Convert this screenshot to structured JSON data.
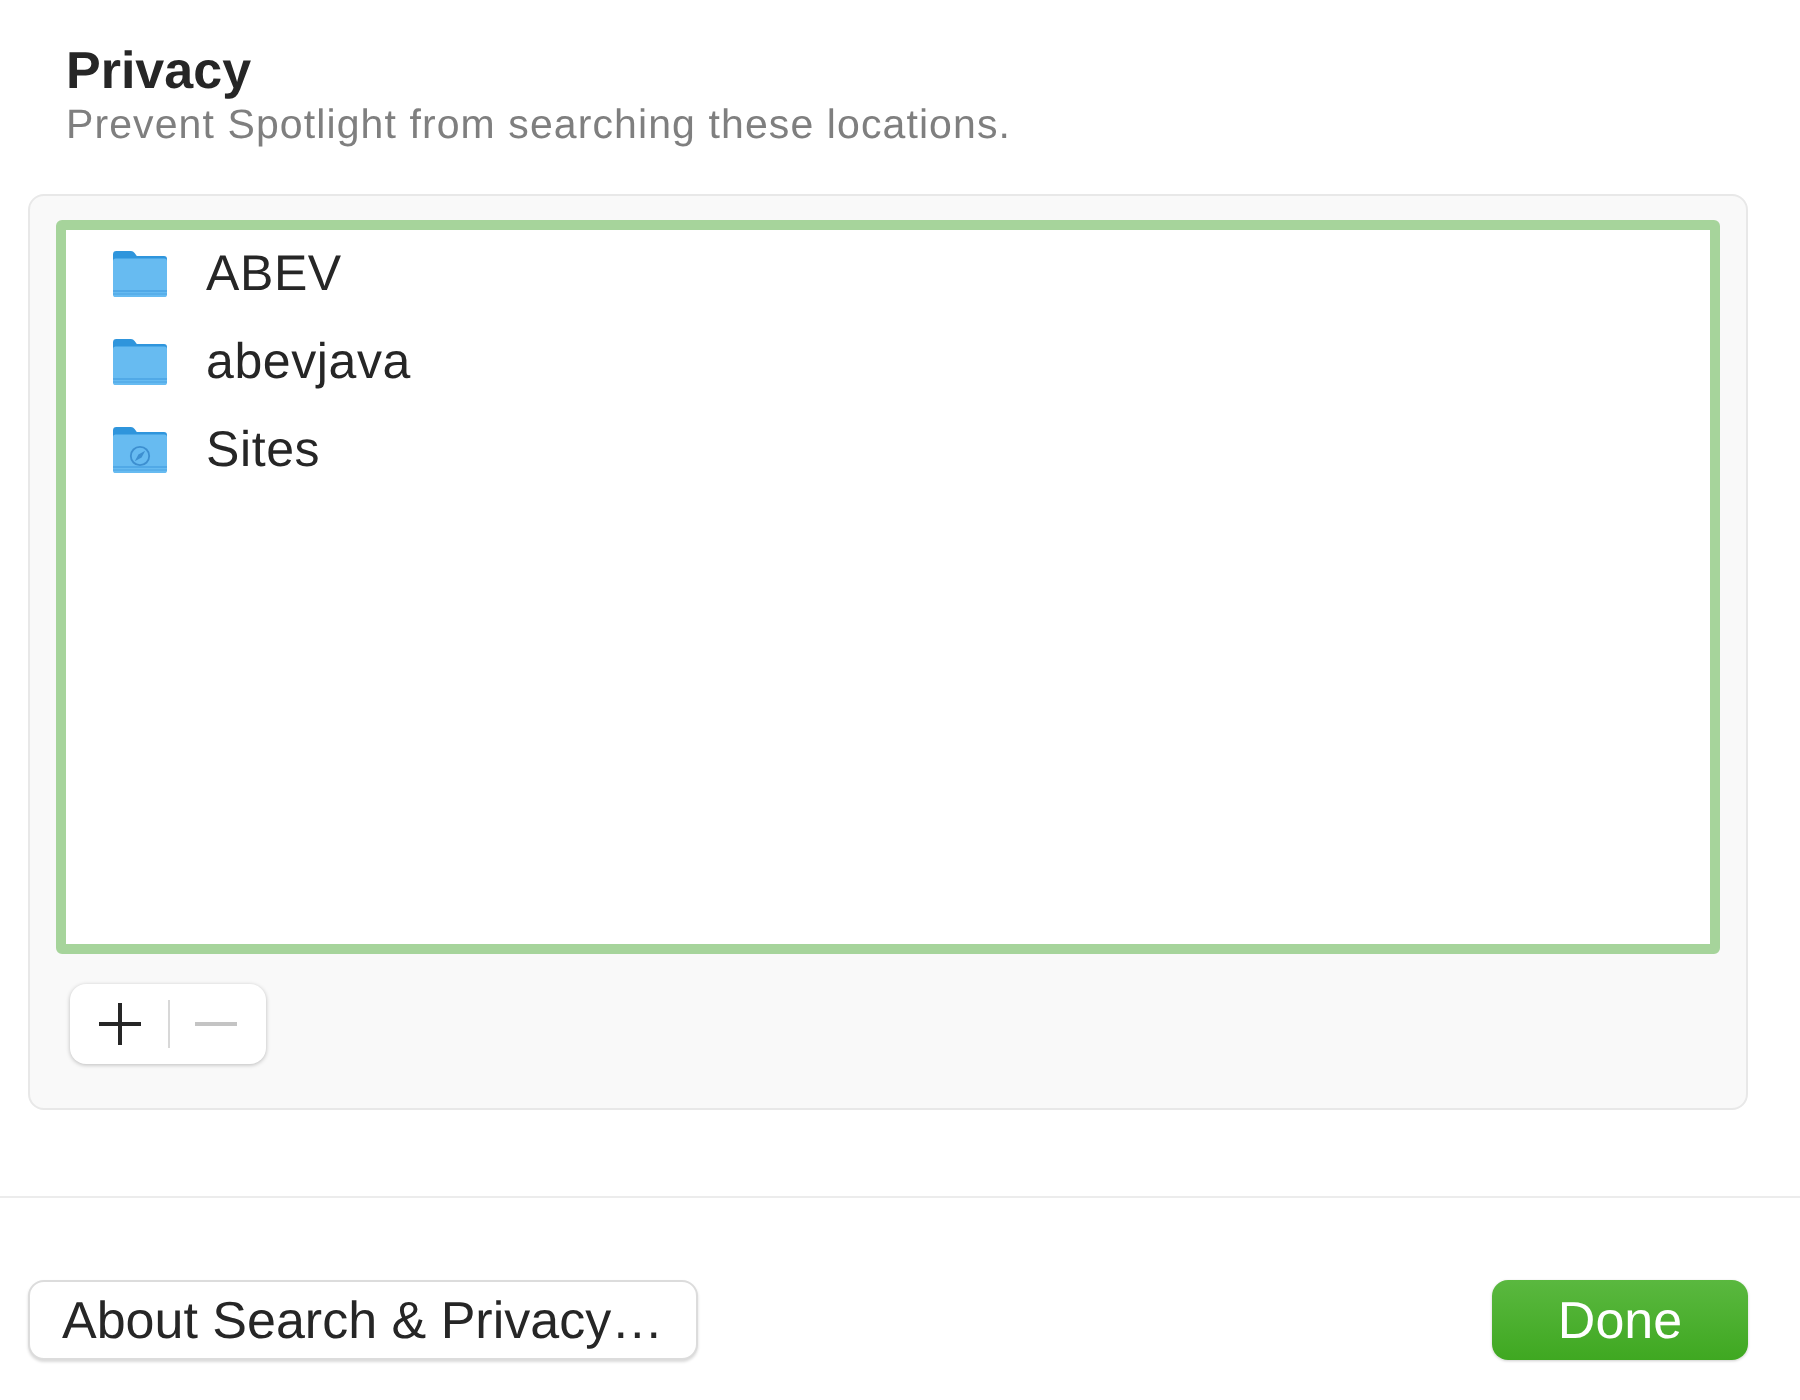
{
  "header": {
    "title": "Privacy",
    "subtitle": "Prevent Spotlight from searching these locations."
  },
  "locations": {
    "focused": true,
    "items": [
      {
        "name": "ABEV",
        "kind": "folder",
        "selected": false
      },
      {
        "name": "abevjava",
        "kind": "folder",
        "selected": false
      },
      {
        "name": "Sites",
        "kind": "web-folder",
        "selected": false
      }
    ]
  },
  "list_buttons": [
    {
      "kind": "add",
      "disabled": false
    },
    {
      "kind": "remove",
      "disabled": true
    }
  ],
  "buttons": [
    {
      "label": "About Search & Privacy…",
      "kind": "default"
    },
    {
      "label": "Done",
      "kind": "primary"
    }
  ]
}
